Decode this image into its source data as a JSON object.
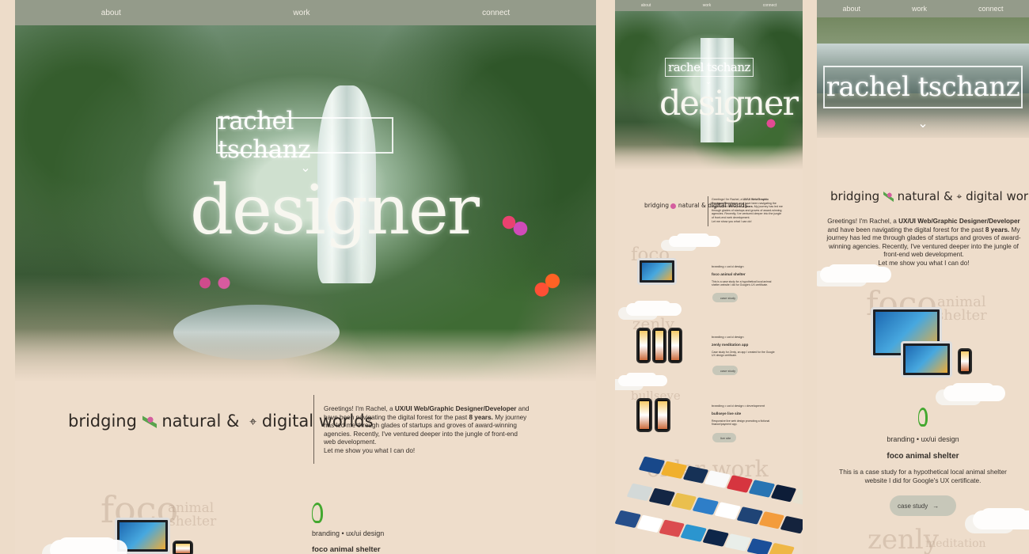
{
  "nav": {
    "about": "about",
    "work": "work",
    "connect": "connect"
  },
  "hero": {
    "name": "rachel tschanz",
    "role": "designer"
  },
  "bridge": {
    "prefix": "bridging",
    "mid": "natural &",
    "suffix": "digital worlds"
  },
  "intro": {
    "p1": "Greetings! I'm Rachel, a ",
    "bold1": "UX/UI Web/Graphic Designer/Developer",
    "p2": " and have been navigating the digital forest for the past ",
    "bold2": "8 years.",
    "p3": " My journey has led me through glades of startups and groves of award-winning agencies. Recently, I've ventured deeper into the jungle of front-end web development.",
    "p4": "Let me show you what I can do!"
  },
  "projects": [
    {
      "ghost": "foco",
      "ghost2": "animal",
      "ghost3": "shelter",
      "category": "branding • ux/ui design",
      "title": "foco animal shelter",
      "description": "This is a case study for a hypothetical local animal shelter website I did for Google's UX certificate.",
      "cta": "case study"
    },
    {
      "ghost": "zenly",
      "ghost2": "meditation",
      "category": "branding • ux/ui design",
      "title": "zenly meditation app",
      "description": "Case study for Zenly, an app I created for the Google UX design certificate.",
      "cta": "case study"
    },
    {
      "ghost": "bullseye",
      "category": "branding • ux/ui design • development",
      "title": "bullseye live site",
      "description": "Responsive live web design promoting a fictional finance/payment app.",
      "cta": "live site"
    }
  ],
  "older": {
    "title": "older work"
  },
  "colors": {
    "bg": "#eeddcb",
    "nav": "#5f7b6a",
    "accent": "#4a7c35",
    "text": "#3a332c"
  }
}
